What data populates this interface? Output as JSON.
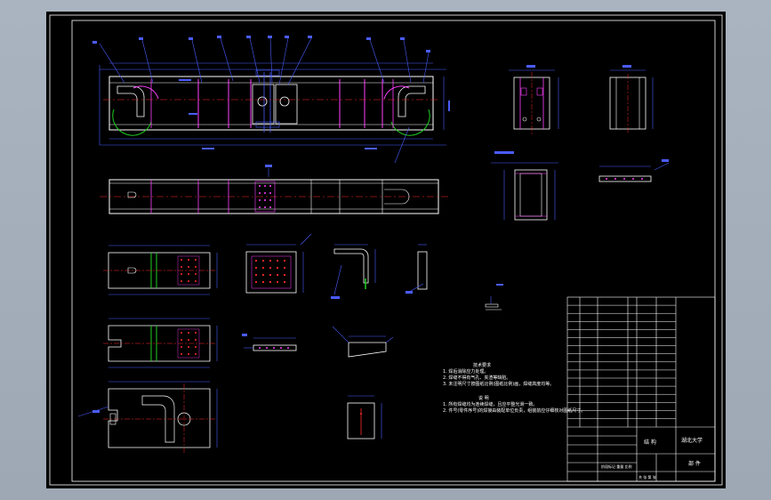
{
  "notes": {
    "tech_title": "技术要求",
    "tech_lines": [
      "1. 焊后消除应力处理。",
      "2. 焊缝不得有气孔、夹渣等缺陷。",
      "3. 未注明尺寸按图纸比例(图纸比例)画，焊缝高度均等。"
    ],
    "explain_title": "说 明",
    "explain_lines": [
      "1. 所有焊缝均为连续焊缝，且应平整光滑一致。",
      "2. 件号(零件序号)的焊接由装配单位负责，组装前应仔细核对图纸尺寸。"
    ]
  },
  "title_block": {
    "drawing_name": "结 构",
    "university": "湖北大学",
    "sub_label": "部 件",
    "scale_row": "阶段标记 重量 比例",
    "sheet_row": "共 张 第 张"
  },
  "colors": {
    "canvas": "#000000",
    "line": "#ffffff",
    "dimension": "#4a5cff",
    "hidden": "#ff2a2a",
    "section": "#ff40ff",
    "green": "#1fd11f",
    "yellow": "#ffff40"
  }
}
